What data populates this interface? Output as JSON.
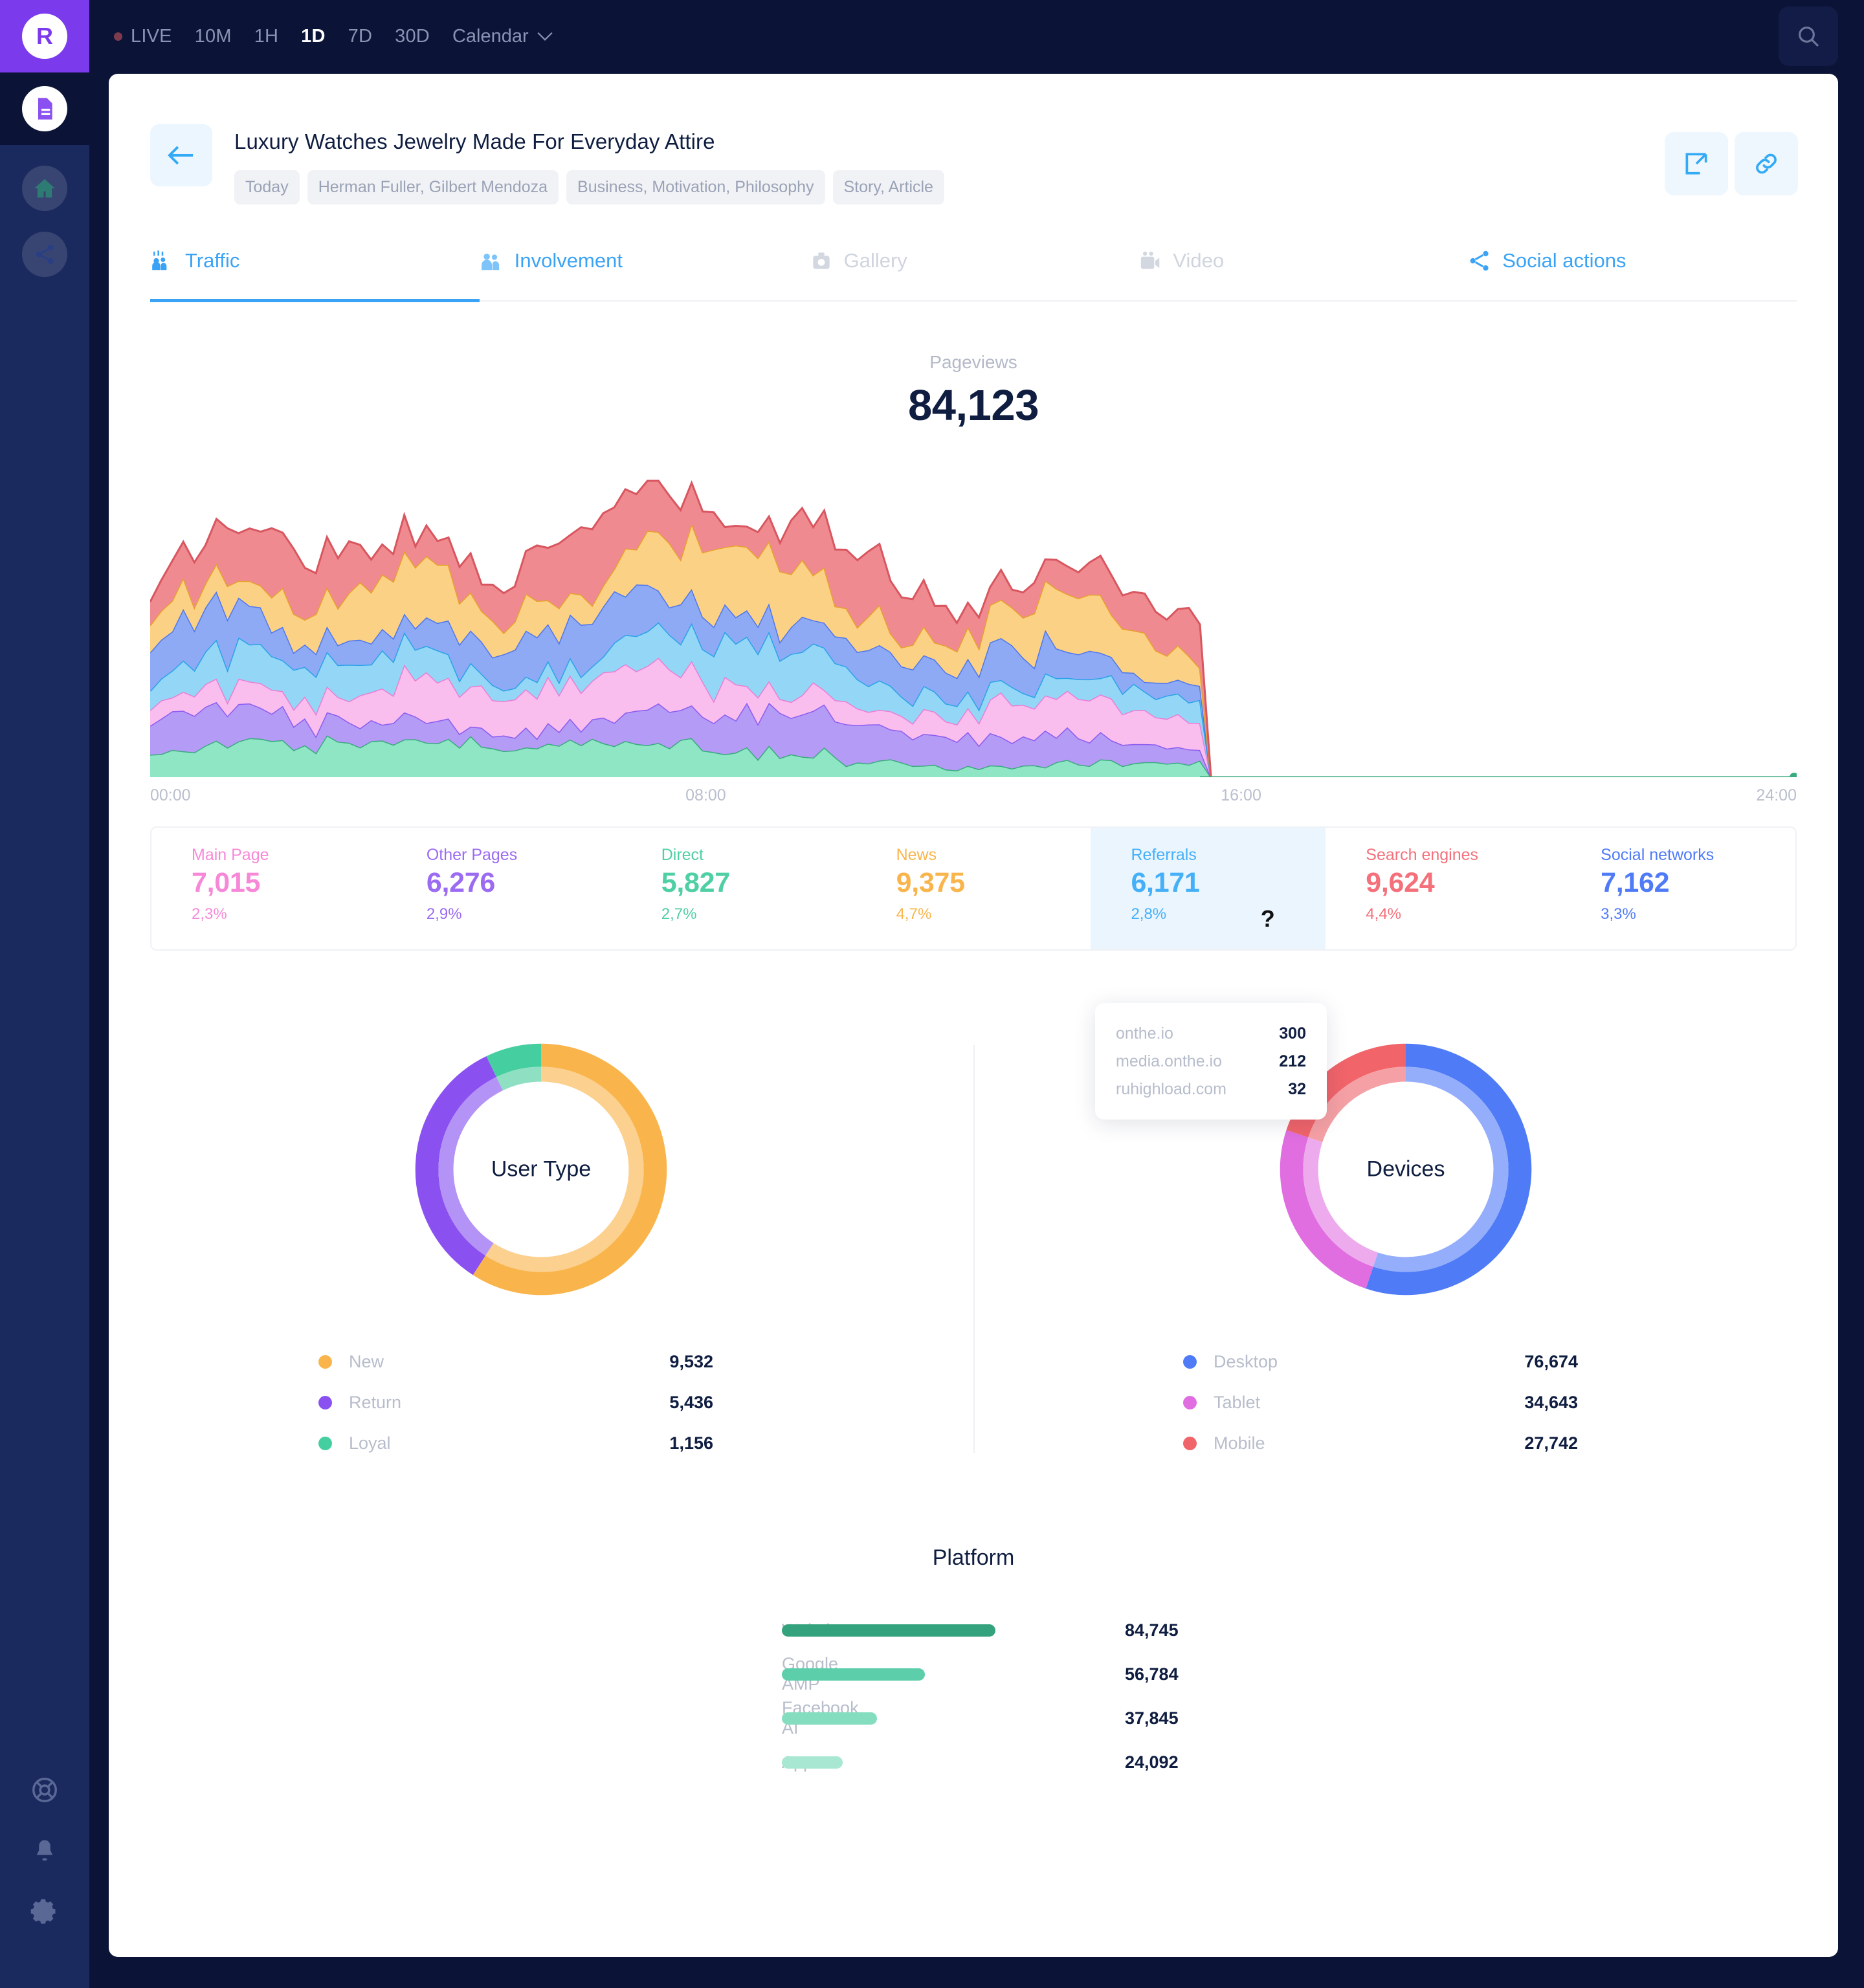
{
  "brand": {
    "logo_letter": "R"
  },
  "topbar": {
    "live_label": "LIVE",
    "ranges": [
      "10M",
      "1H",
      "1D",
      "7D",
      "30D"
    ],
    "selected_range": "1D",
    "calendar_label": "Calendar",
    "search_icon": "search-icon"
  },
  "sidebar": {
    "items": [
      {
        "icon": "document-icon",
        "state": "active"
      },
      {
        "icon": "home-icon",
        "state": "dim"
      },
      {
        "icon": "share-icon",
        "state": "dim"
      }
    ],
    "bottom_items": [
      {
        "icon": "lifebuoy-icon"
      },
      {
        "icon": "bell-icon"
      },
      {
        "icon": "gear-icon"
      }
    ]
  },
  "header": {
    "back_icon": "arrow-left-icon",
    "title": "Luxury Watches Jewelry Made For Everyday Attire",
    "tags": [
      "Today",
      "Herman Fuller, Gilbert Mendoza",
      "Business, Motivation, Philosophy",
      "Story, Article"
    ],
    "actions": [
      {
        "icon": "external-link-icon"
      },
      {
        "icon": "link-icon"
      }
    ]
  },
  "tabs": [
    {
      "label": "Traffic",
      "icon": "people-traffic-icon",
      "state": "active"
    },
    {
      "label": "Involvement",
      "icon": "people-icon",
      "state": "enabled"
    },
    {
      "label": "Gallery",
      "icon": "camera-icon",
      "state": "disabled"
    },
    {
      "label": "Video",
      "icon": "video-camera-icon",
      "state": "disabled"
    },
    {
      "label": "Social actions",
      "icon": "share-nodes-icon",
      "state": "enabled"
    }
  ],
  "pageviews": {
    "label": "Pageviews",
    "value": "84,123"
  },
  "metrics": [
    {
      "name": "Main Page",
      "value": "7,015",
      "pct": "2,3%",
      "color": "#f788d8",
      "highlight": false
    },
    {
      "name": "Other Pages",
      "value": "6,276",
      "pct": "2,9%",
      "color": "#9b6bf2",
      "highlight": false
    },
    {
      "name": "Direct",
      "value": "5,827",
      "pct": "2,7%",
      "color": "#4ecfa4",
      "highlight": false
    },
    {
      "name": "News",
      "value": "9,375",
      "pct": "4,7%",
      "color": "#f9b54c",
      "highlight": false
    },
    {
      "name": "Referrals",
      "value": "6,171",
      "pct": "2,8%",
      "color": "#45b0f8",
      "highlight": true
    },
    {
      "name": "Search engines",
      "value": "9,624",
      "pct": "4,4%",
      "color": "#f4707a",
      "highlight": false
    },
    {
      "name": "Social networks",
      "value": "7,162",
      "pct": "3,3%",
      "color": "#4f7bf7",
      "highlight": false
    }
  ],
  "referrals_tooltip": {
    "rows": [
      {
        "name": "onthe.io",
        "value": "300"
      },
      {
        "name": "media.onthe.io",
        "value": "212"
      },
      {
        "name": "ruhighload.com",
        "value": "32"
      }
    ]
  },
  "chart_data": [
    {
      "type": "area",
      "title": "Pageviews",
      "xlabel": "",
      "ylabel": "",
      "stacked": true,
      "grid": false,
      "legend": "below",
      "x_ticks": [
        "00:00",
        "08:00",
        "16:00",
        "24:00"
      ],
      "xlim": [
        0,
        24
      ],
      "series": [
        {
          "name": "Direct",
          "color": "#8fe6c4",
          "line": "#3aaa7f",
          "total": 5827
        },
        {
          "name": "Other Pages",
          "color": "#b49bf5",
          "line": "#8a5cf0",
          "total": 6276
        },
        {
          "name": "Main Page",
          "color": "#f9bdee",
          "line": "#e97fd4",
          "total": 7015
        },
        {
          "name": "Referrals",
          "color": "#93d6f6",
          "line": "#2ba2e8",
          "total": 6171
        },
        {
          "name": "Social networks",
          "color": "#8eaaf5",
          "line": "#4e76ec",
          "total": 7162
        },
        {
          "name": "News",
          "color": "#fbd285",
          "line": "#e7a12c",
          "total": 9375
        },
        {
          "name": "Search engines",
          "color": "#ef8b90",
          "line": "#d8565f",
          "total": 9624
        }
      ]
    },
    {
      "type": "pie",
      "title": "User Type",
      "labels": [
        "New",
        "Return",
        "Loyal"
      ],
      "values": [
        9532,
        5436,
        1156
      ],
      "value_labels": [
        "9,532",
        "5,436",
        "1,156"
      ],
      "colors": [
        "#f9b54c",
        "#8b50f0",
        "#45cfa0"
      ],
      "inner_colors": [
        "#fcd08e",
        "#b493f6",
        "#8fe0c2"
      ],
      "legend": "below"
    },
    {
      "type": "pie",
      "title": "Devices",
      "labels": [
        "Desktop",
        "Tablet",
        "Mobile"
      ],
      "values": [
        76674,
        34643,
        27742
      ],
      "value_labels": [
        "76,674",
        "34,643",
        "27,742"
      ],
      "colors": [
        "#4f7bf7",
        "#e06ee0",
        "#f0646a"
      ],
      "inner_colors": [
        "#94aefb",
        "#edabee",
        "#f5a0a4"
      ],
      "legend": "below"
    },
    {
      "type": "bar",
      "title": "Platform",
      "orientation": "horizontal",
      "categories": [
        "Website",
        "Google AMP",
        "Facebook AI",
        "App"
      ],
      "values": [
        84745,
        56784,
        37845,
        24092
      ],
      "value_labels": [
        "84,745",
        "56,784",
        "37,845",
        "24,092"
      ],
      "colors": [
        "#33a27d",
        "#5cceaa",
        "#84ddbe",
        "#a8e7d1"
      ],
      "xlim": [
        0,
        84745
      ],
      "grid": false
    }
  ]
}
